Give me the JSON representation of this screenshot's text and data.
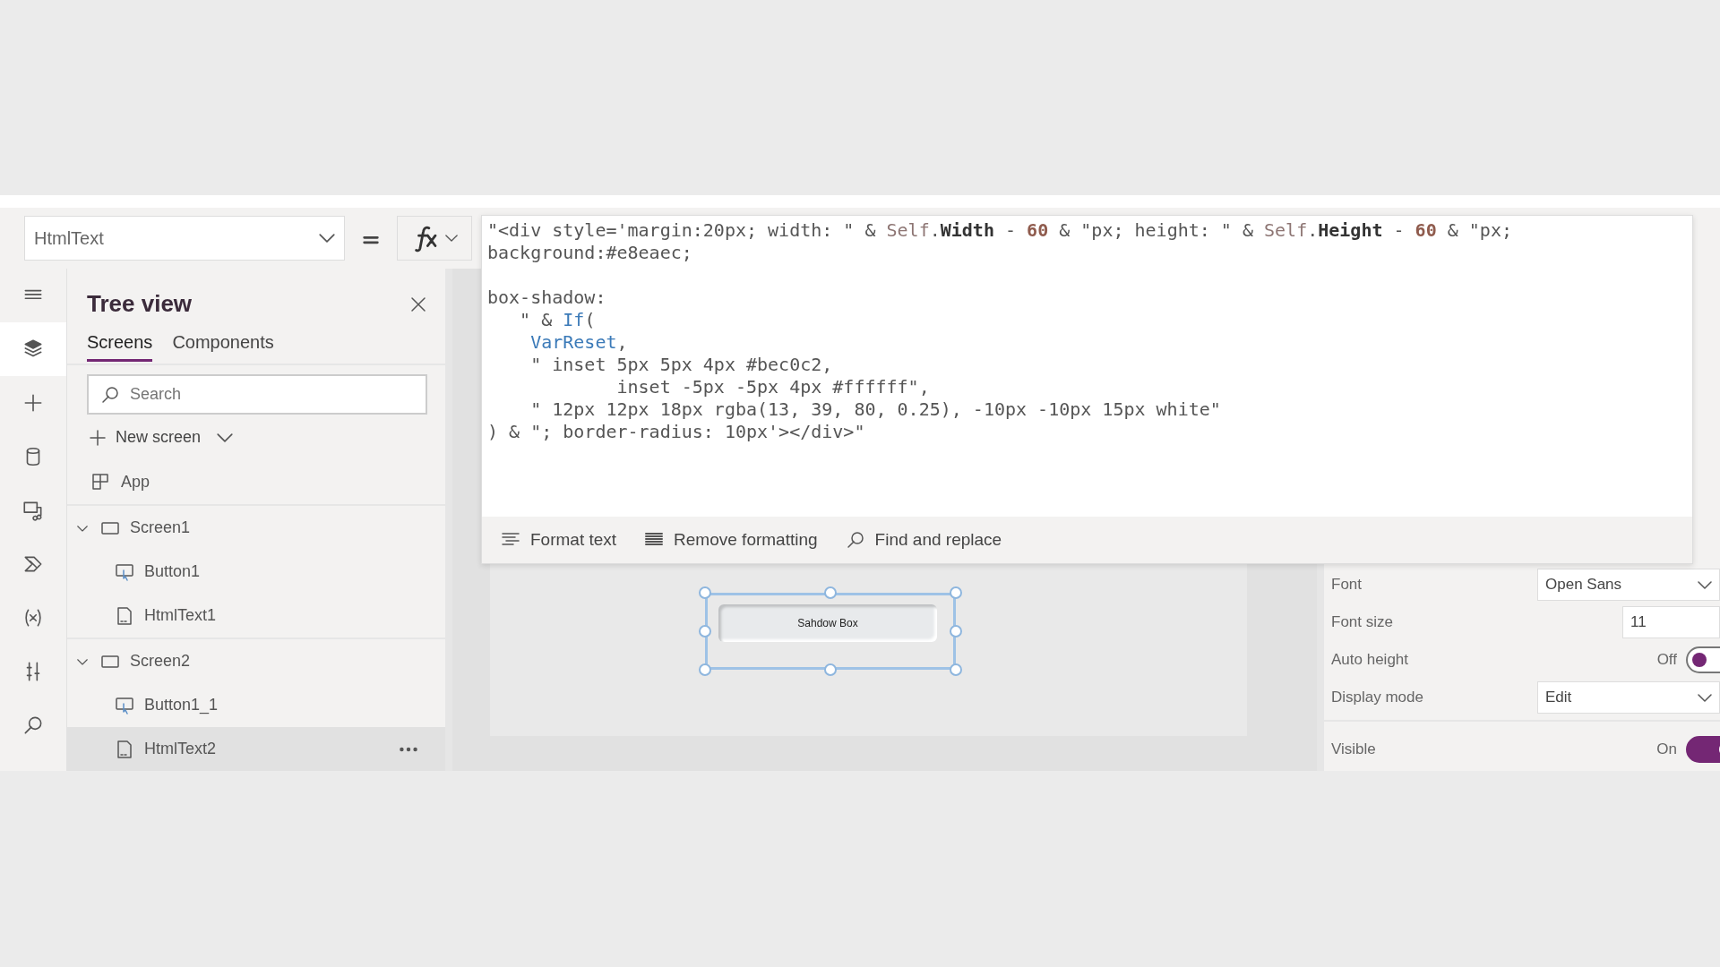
{
  "property_selector": {
    "value": "HtmlText"
  },
  "formula": {
    "lines": [
      {
        "tokens": [
          {
            "kind": "plain",
            "t": "\"<div style='margin:20px; width: \" & "
          },
          {
            "kind": "ref",
            "t": "Self"
          },
          {
            "kind": "plain",
            "t": "."
          },
          {
            "kind": "prop",
            "t": "Width"
          },
          {
            "kind": "plain",
            "t": " - "
          },
          {
            "kind": "num",
            "t": "60"
          },
          {
            "kind": "plain",
            "t": " & \"px; height: \" & "
          },
          {
            "kind": "ref",
            "t": "Self"
          },
          {
            "kind": "plain",
            "t": "."
          },
          {
            "kind": "prop",
            "t": "Height"
          },
          {
            "kind": "plain",
            "t": " - "
          },
          {
            "kind": "num",
            "t": "60"
          },
          {
            "kind": "plain",
            "t": " & \"px;"
          }
        ]
      },
      {
        "tokens": [
          {
            "kind": "plain",
            "t": "background:#e8eaec;"
          }
        ]
      },
      {
        "blank_before": true,
        "tokens": [
          {
            "kind": "plain",
            "t": "box-shadow:"
          }
        ]
      },
      {
        "tokens": [
          {
            "kind": "plain",
            "t": "   \" & "
          },
          {
            "kind": "func",
            "t": "If"
          },
          {
            "kind": "plain",
            "t": "("
          }
        ]
      },
      {
        "tokens": [
          {
            "kind": "func",
            "t": "    VarReset"
          },
          {
            "kind": "plain",
            "t": ","
          }
        ]
      },
      {
        "tokens": [
          {
            "kind": "plain",
            "t": "    \" inset 5px 5px 4px #bec0c2,"
          }
        ]
      },
      {
        "tokens": [
          {
            "kind": "plain",
            "t": "            inset -5px -5px 4px #ffffff\","
          }
        ]
      },
      {
        "tokens": [
          {
            "kind": "plain",
            "t": "    \" 12px 12px 18px rgba(13, 39, 80, 0.25), -10px -10px 15px white\""
          }
        ]
      },
      {
        "tokens": [
          {
            "kind": "plain",
            "t": ") & \"; border-radius: 10px'></div>\""
          }
        ]
      }
    ],
    "toolbar": [
      {
        "kind": "format",
        "label": "Format text"
      },
      {
        "kind": "remove",
        "label": "Remove formatting"
      },
      {
        "kind": "find",
        "label": "Find and replace"
      }
    ]
  },
  "rail": [
    {
      "kind": "menu",
      "selected": false
    },
    {
      "kind": "tree",
      "selected": true
    },
    {
      "kind": "insert",
      "selected": false
    },
    {
      "kind": "data",
      "selected": false
    },
    {
      "kind": "media",
      "selected": false
    },
    {
      "kind": "flow",
      "selected": false
    },
    {
      "kind": "variables",
      "selected": false
    },
    {
      "kind": "tools",
      "selected": false
    },
    {
      "kind": "search",
      "selected": false
    }
  ],
  "tree_view": {
    "title": "Tree view",
    "tabs": [
      {
        "label": "Screens",
        "selected": true
      },
      {
        "label": "Components",
        "selected": false
      }
    ],
    "search": {
      "placeholder": "Search"
    },
    "new_screen": "New screen",
    "items": [
      {
        "kind": "app",
        "label": "App",
        "selected": false
      },
      {
        "kind": "screen",
        "label": "Screen1",
        "expanded": true,
        "selected": false,
        "children": [
          {
            "kind": "button",
            "label": "Button1",
            "selected": false
          },
          {
            "kind": "html",
            "label": "HtmlText1",
            "selected": false
          }
        ]
      },
      {
        "kind": "screen",
        "label": "Screen2",
        "expanded": true,
        "selected": false,
        "children": [
          {
            "kind": "button",
            "label": "Button1_1",
            "selected": false
          },
          {
            "kind": "html",
            "label": "HtmlText2",
            "selected": true
          }
        ]
      }
    ]
  },
  "canvas": {
    "control_text": "Sahdow Box"
  },
  "properties": [
    {
      "kind": "dropdown",
      "label": "Font",
      "value": "Open Sans"
    },
    {
      "kind": "input",
      "label": "Font size",
      "value": "11"
    },
    {
      "kind": "toggle",
      "label": "Auto height",
      "state_text": "Off",
      "on": false
    },
    {
      "kind": "dropdown",
      "label": "Display mode",
      "value": "Edit"
    },
    {
      "kind": "toggle",
      "label": "Visible",
      "state_text": "On",
      "on": true,
      "divider_before": true
    }
  ]
}
